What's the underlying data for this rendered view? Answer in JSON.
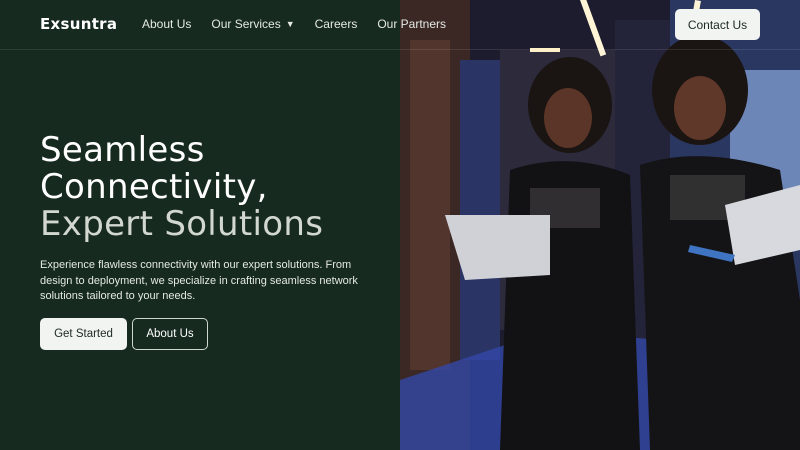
{
  "brand": {
    "name": "Exsuntra"
  },
  "nav": {
    "items": [
      {
        "label": "About Us"
      },
      {
        "label": "Our Services",
        "has_dropdown": true
      },
      {
        "label": "Careers"
      },
      {
        "label": "Our Partners"
      }
    ],
    "dropdown_icon": "caret-down-icon",
    "contact_label": "Contact Us"
  },
  "hero": {
    "title_line1": "Seamless",
    "title_line2": "Connectivity,",
    "title_line3": "Expert Solutions",
    "description": "Experience flawless connectivity with our expert solutions. From design to deployment, we specialize in crafting seamless network solutions tailored to your needs.",
    "primary_cta": "Get Started",
    "secondary_cta": "About Us"
  },
  "colors": {
    "background": "#162a1f",
    "button_bg": "#f2f4f2",
    "button_text": "#1c2a22",
    "title_muted": "#d2d7cf"
  }
}
